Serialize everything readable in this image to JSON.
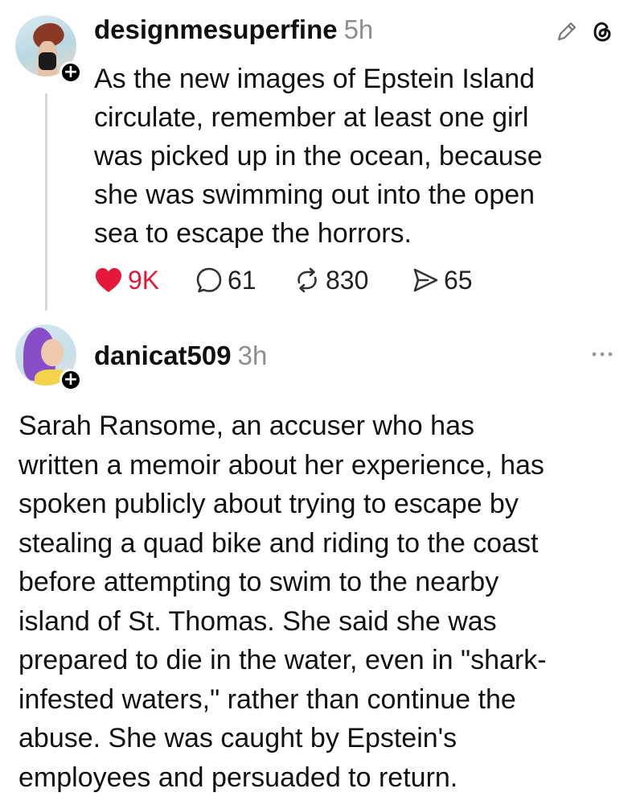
{
  "post": {
    "username": "designmesuperfine",
    "time": "5h",
    "text": "As the new images of Epstein Island\ncirculate, remember at least one girl\nwas picked up in the ocean, because\nshe was swimming out into the open\nsea to escape the horrors.",
    "likes": "9K",
    "replies": "61",
    "reposts": "830",
    "shares": "65",
    "icons": {
      "edit": "pencil-icon",
      "app": "threads-icon",
      "like": "heart-icon",
      "reply": "comment-icon",
      "repost": "repost-icon",
      "share": "share-icon",
      "follow": "plus-icon"
    },
    "like_color": "#e4183b"
  },
  "reply": {
    "username": "danicat509",
    "time": "3h",
    "text": "Sarah Ransome, an accuser who has\nwritten a memoir about her experience, has\nspoken publicly about trying to escape by\nstealing a quad bike and riding to the coast\nbefore attempting to swim to the nearby\nisland of St. Thomas. She said she was\nprepared to die in the water, even in \"shark-\ninfested waters,\" rather than continue the\nabuse. She was caught by Epstein's\nemployees and persuaded to return.",
    "icons": {
      "more": "more-options-icon",
      "follow": "plus-icon"
    }
  }
}
